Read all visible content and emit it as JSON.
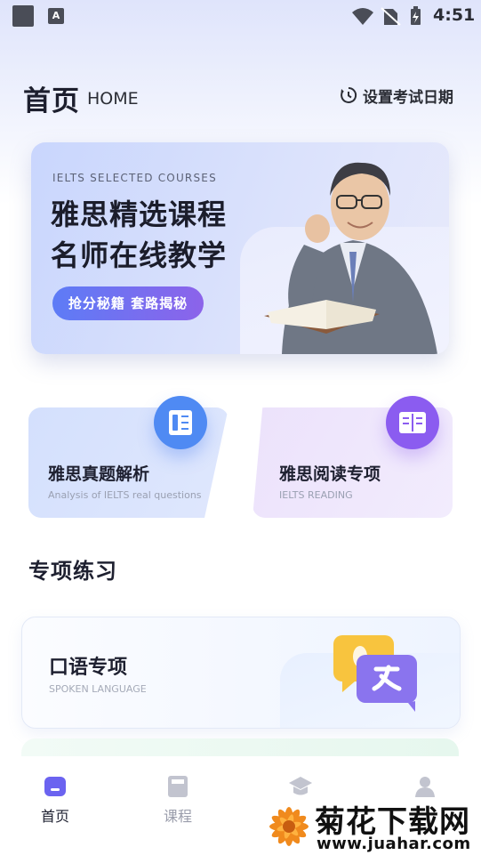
{
  "status_bar": {
    "time": "4:51",
    "notification_icon": "A"
  },
  "header": {
    "title": "首页",
    "title_en": "HOME",
    "exam_date_label": "设置考试日期"
  },
  "banner": {
    "subtitle_en": "IELTS SELECTED COURSES",
    "line1": "雅思精选课程",
    "line2": "名师在线教学",
    "button_label": "抢分秘籍  套路揭秘"
  },
  "cards": [
    {
      "title": "雅思真题解析",
      "subtitle": "Analysis of IELTS real questions",
      "icon": "notebook-icon"
    },
    {
      "title": "雅思阅读专项",
      "subtitle": "IELTS READING",
      "icon": "book-open-icon"
    }
  ],
  "section": {
    "title": "专项练习"
  },
  "spoken": {
    "title": "口语专项",
    "subtitle": "SPOKEN LANGUAGE",
    "icon": "translate-bubbles-icon"
  },
  "nav": {
    "items": [
      {
        "label": "首页",
        "icon": "home-icon",
        "active": true
      },
      {
        "label": "课程",
        "icon": "course-icon",
        "active": false
      },
      {
        "label": "",
        "icon": "graduation-cap-icon",
        "active": false
      },
      {
        "label": "",
        "icon": "user-icon",
        "active": false
      }
    ]
  },
  "watermark": {
    "text": "菊花下载网",
    "url": "www.juahar.com"
  },
  "colors": {
    "accent_blue": "#4f8af3",
    "accent_purple": "#8b5cf0",
    "active_nav": "#6b63f0",
    "inactive_nav": "#b9bcc8"
  }
}
